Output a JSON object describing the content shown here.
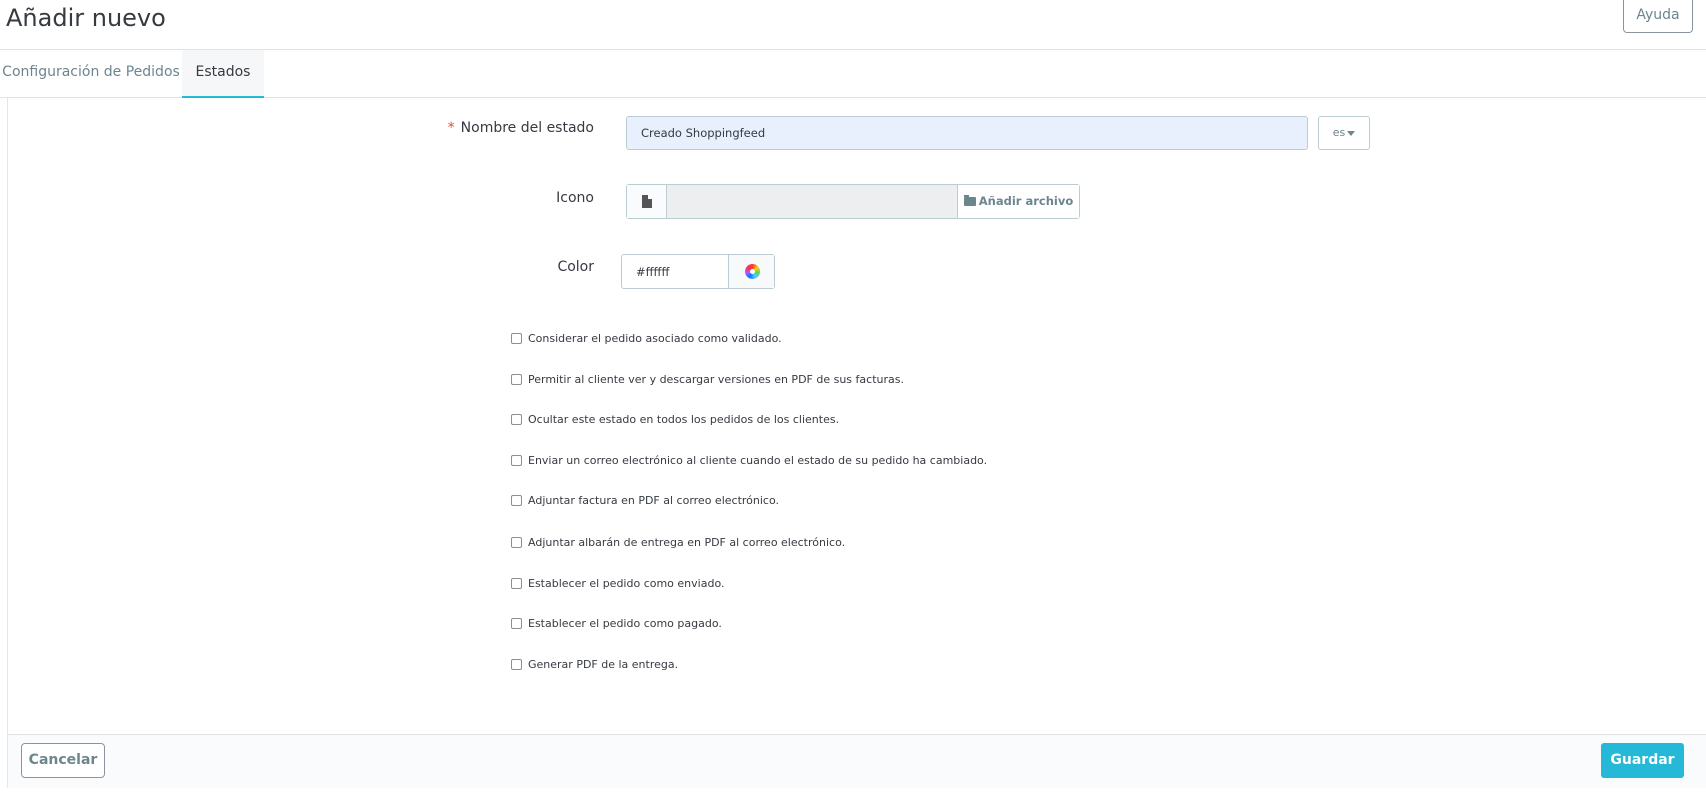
{
  "header": {
    "title": "Añadir nuevo",
    "help_label": "Ayuda"
  },
  "tabs": [
    {
      "label": "Configuración de Pedidos",
      "active": false
    },
    {
      "label": "Estados",
      "active": true
    }
  ],
  "form": {
    "name": {
      "label": "Nombre del estado",
      "required_mark": "*",
      "value": "Creado Shoppingfeed",
      "lang": "es"
    },
    "icon": {
      "label": "Icono",
      "add_file_label": "Añadir archivo"
    },
    "color": {
      "label": "Color",
      "value": "#ffffff"
    },
    "checkboxes": [
      {
        "label": "Considerar el pedido asociado como validado.",
        "checked": false
      },
      {
        "label": "Permitir al cliente ver y descargar versiones en PDF de sus facturas.",
        "checked": false
      },
      {
        "label": "Ocultar este estado en todos los pedidos de los clientes.",
        "checked": false
      },
      {
        "label": "Enviar un correo electrónico al cliente cuando el estado de su pedido ha cambiado.",
        "checked": false
      },
      {
        "label": "Adjuntar factura en PDF al correo electrónico.",
        "checked": false
      },
      {
        "label": "Adjuntar albarán de entrega en PDF al correo electrónico.",
        "checked": false
      },
      {
        "label": "Establecer el pedido como enviado.",
        "checked": false
      },
      {
        "label": "Establecer el pedido como pagado.",
        "checked": false
      },
      {
        "label": "Generar PDF de la entrega.",
        "checked": false
      }
    ]
  },
  "footer": {
    "cancel_label": "Cancelar",
    "save_label": "Guardar"
  },
  "colors": {
    "accent": "#25b9d7",
    "required": "#e24b3b",
    "input_autofill_bg": "#e8f0fe"
  }
}
